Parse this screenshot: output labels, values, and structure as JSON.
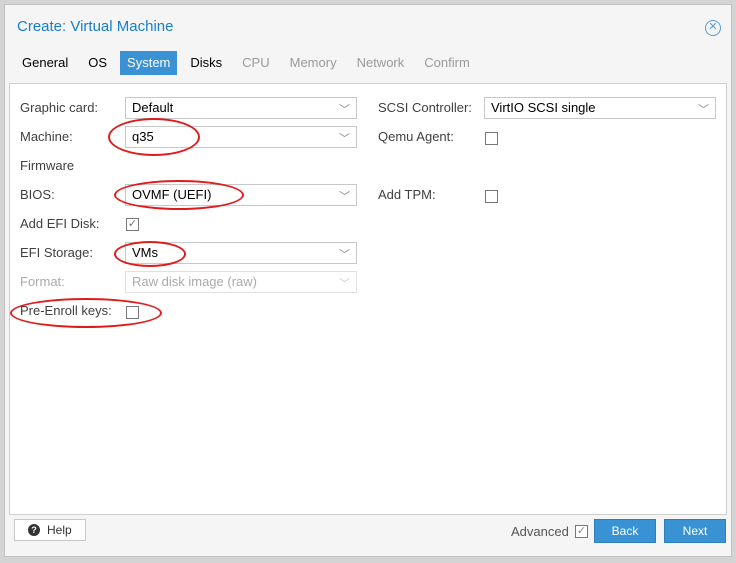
{
  "window": {
    "title": "Create: Virtual Machine"
  },
  "tabs": [
    {
      "label": "General",
      "state": "normal"
    },
    {
      "label": "OS",
      "state": "normal"
    },
    {
      "label": "System",
      "state": "active"
    },
    {
      "label": "Disks",
      "state": "normal"
    },
    {
      "label": "CPU",
      "state": "disabled"
    },
    {
      "label": "Memory",
      "state": "disabled"
    },
    {
      "label": "Network",
      "state": "disabled"
    },
    {
      "label": "Confirm",
      "state": "disabled"
    }
  ],
  "form": {
    "graphic_card": {
      "label": "Graphic card:",
      "value": "Default"
    },
    "machine": {
      "label": "Machine:",
      "value": "q35"
    },
    "firmware_heading": "Firmware",
    "bios": {
      "label": "BIOS:",
      "value": "OVMF (UEFI)"
    },
    "add_efi_disk": {
      "label": "Add EFI Disk:",
      "checked": true
    },
    "efi_storage": {
      "label": "EFI Storage:",
      "value": "VMs"
    },
    "format": {
      "label": "Format:",
      "value": "Raw disk image (raw)"
    },
    "pre_enroll_keys": {
      "label": "Pre-Enroll keys:",
      "checked": false
    },
    "scsi_controller": {
      "label": "SCSI Controller:",
      "value": "VirtIO SCSI single"
    },
    "qemu_agent": {
      "label": "Qemu Agent:",
      "checked": false
    },
    "add_tpm": {
      "label": "Add TPM:",
      "checked": false
    }
  },
  "footer": {
    "help": "Help",
    "advanced": "Advanced",
    "advanced_checked": true,
    "back": "Back",
    "next": "Next"
  },
  "colors": {
    "accent": "#3892d4",
    "title": "#157fcc",
    "annotation": "#e11b1b"
  }
}
